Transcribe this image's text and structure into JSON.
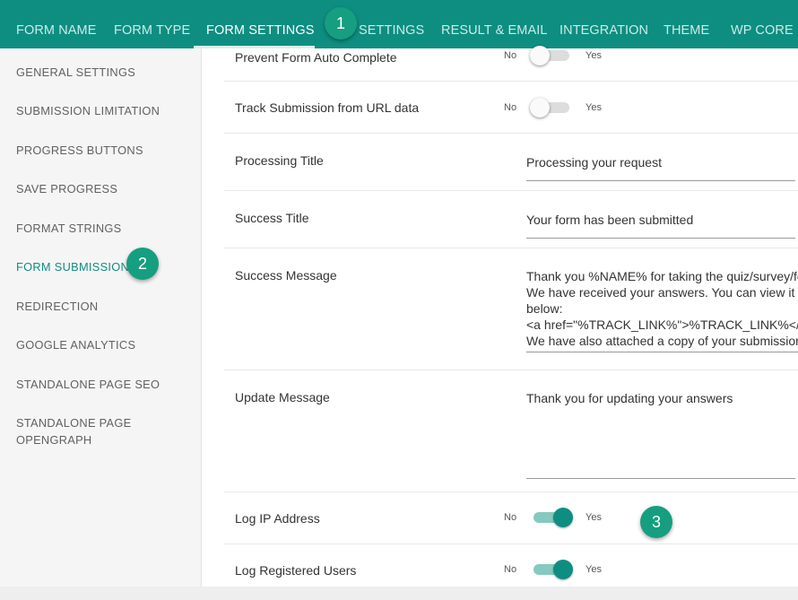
{
  "tabs": [
    {
      "label": "FORM NAME"
    },
    {
      "label": "FORM TYPE"
    },
    {
      "label": "FORM SETTINGS"
    },
    {
      "label": "SETTINGS"
    },
    {
      "label": "RESULT & EMAIL"
    },
    {
      "label": "INTEGRATION"
    },
    {
      "label": "THEME"
    },
    {
      "label": "WP CORE"
    }
  ],
  "sidebar": {
    "items": [
      {
        "label": "GENERAL SETTINGS"
      },
      {
        "label": "SUBMISSION LIMITATION"
      },
      {
        "label": "PROGRESS BUTTONS"
      },
      {
        "label": "SAVE PROGRESS"
      },
      {
        "label": "FORMAT STRINGS"
      },
      {
        "label": "FORM SUBMISSION"
      },
      {
        "label": "REDIRECTION"
      },
      {
        "label": "GOOGLE ANALYTICS"
      },
      {
        "label": "STANDALONE PAGE SEO"
      },
      {
        "label": "STANDALONE PAGE\nOPENGRAPH"
      }
    ]
  },
  "settings": {
    "prevent_autocomplete": {
      "label": "Prevent Form Auto Complete",
      "no": "No",
      "yes": "Yes",
      "value": false
    },
    "track_url": {
      "label": "Track Submission from URL data",
      "no": "No",
      "yes": "Yes",
      "value": false
    },
    "processing_title": {
      "label": "Processing Title",
      "value": "Processing your request"
    },
    "success_title": {
      "label": "Success Title",
      "value": "Your form has been submitted"
    },
    "success_message": {
      "label": "Success Message",
      "value": "Thank you %NAME% for taking the quiz/survey/feedb\nWe have received your answers. You can view it anyti\nbelow:\n<a href=\"%TRACK_LINK%\">%TRACK_LINK%</a>\nWe have also attached a copy of your submission."
    },
    "update_message": {
      "label": "Update Message",
      "value": "Thank you for updating your answers"
    },
    "log_ip": {
      "label": "Log IP Address",
      "no": "No",
      "yes": "Yes",
      "value": true
    },
    "log_registered": {
      "label": "Log Registered Users",
      "no": "No",
      "yes": "Yes",
      "value": true
    }
  },
  "annotations": [
    "1",
    "2",
    "3"
  ],
  "colors": {
    "accent": "#0e8e81",
    "badge": "#169e80"
  }
}
